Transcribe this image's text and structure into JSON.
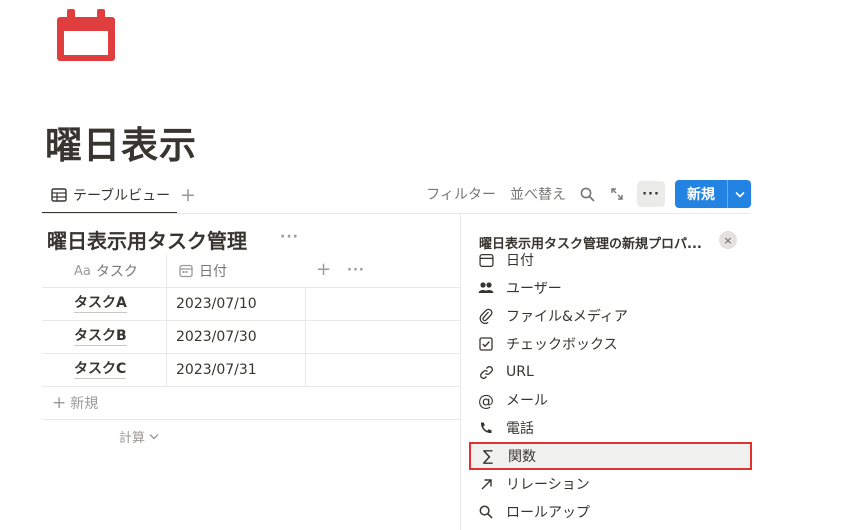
{
  "page": {
    "title": "曜日表示",
    "icon": "calendar-icon",
    "icon_color": "#e03e3e"
  },
  "view_bar": {
    "tab_label": "テーブルビュー",
    "tab_icon": "table-icon",
    "add_view": "+",
    "filter_label": "フィルター",
    "sort_label": "並べ替え",
    "more_label": "···",
    "new_label": "新規",
    "accent": "#2383e2"
  },
  "database": {
    "title": "曜日表示用タスク管理",
    "more_label": "···",
    "columns": [
      {
        "label": "タスク",
        "prefix": "Aa"
      },
      {
        "label": "日付",
        "icon": "calendar-small-icon"
      }
    ],
    "add_column": "+",
    "column_more": "···",
    "rows": [
      {
        "task": "タスクA",
        "date": "2023/07/10"
      },
      {
        "task": "タスクB",
        "date": "2023/07/30"
      },
      {
        "task": "タスクC",
        "date": "2023/07/31"
      }
    ],
    "add_row_label": "新規",
    "calc_label": "計算"
  },
  "panel": {
    "title": "曜日表示用タスク管理の新規プロパ...",
    "close": "×",
    "properties": [
      {
        "label": "日付",
        "icon": "calendar-small-icon"
      },
      {
        "label": "ユーザー",
        "icon": "people-icon"
      },
      {
        "label": "ファイル&メディア",
        "icon": "paperclip-icon"
      },
      {
        "label": "チェックボックス",
        "icon": "checkbox-icon"
      },
      {
        "label": "URL",
        "icon": "link-icon"
      },
      {
        "label": "メール",
        "icon": "at-icon"
      },
      {
        "label": "電話",
        "icon": "phone-icon"
      },
      {
        "label": "関数",
        "icon": "sigma-icon"
      },
      {
        "label": "リレーション",
        "icon": "arrow-up-right-icon"
      },
      {
        "label": "ロールアップ",
        "icon": "search-icon"
      }
    ],
    "highlight_color": "#e03131"
  }
}
